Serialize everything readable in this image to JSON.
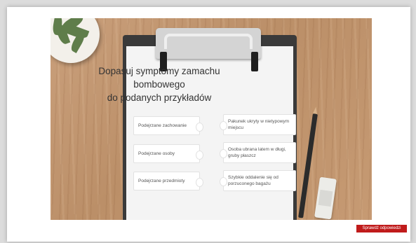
{
  "exercise": {
    "title_line1": "Dopasuj symptomy zamachu bombowego",
    "title_line2": "do podanych przykładów",
    "left_pieces": [
      {
        "label": "Podejrzane zachowanie"
      },
      {
        "label": "Podejrzane osoby"
      },
      {
        "label": "Podejrzane przedmioty"
      }
    ],
    "right_pieces": [
      {
        "label": "Pakunek ukryty w nietypowym miejscu"
      },
      {
        "label": "Osoba ubrana latem w długi, gruby płaszcz"
      },
      {
        "label": "Szybkie oddalenie się od porzuconego bagażu"
      }
    ]
  },
  "footer": {
    "check_label": "Sprawdź odpowiedzi"
  },
  "colors": {
    "accent": "#c01b1b",
    "board": "#3a3a3a",
    "paper": "#f4f4f4"
  }
}
